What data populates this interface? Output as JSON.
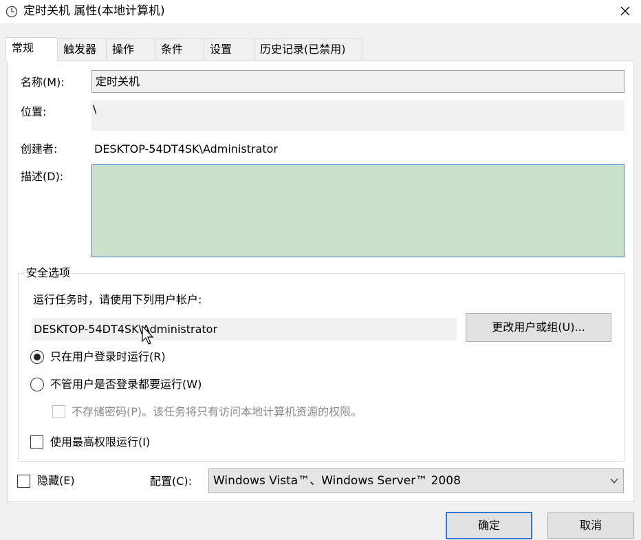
{
  "window": {
    "title": "定时关机 属性(本地计算机)",
    "close_glyph": "✕"
  },
  "tabs": [
    {
      "label": "常规",
      "active": true
    },
    {
      "label": "触发器",
      "active": false
    },
    {
      "label": "操作",
      "active": false
    },
    {
      "label": "条件",
      "active": false
    },
    {
      "label": "设置",
      "active": false
    },
    {
      "label": "历史记录(已禁用)",
      "active": false
    }
  ],
  "general": {
    "name_label": "名称(M):",
    "name_value": "定时关机",
    "location_label": "位置:",
    "location_value": "\\",
    "author_label": "创建者:",
    "author_value": "DESKTOP-54DT4SK\\Administrator",
    "description_label": "描述(D):",
    "description_value": ""
  },
  "security": {
    "group_title": "安全选项",
    "run_as_prompt": "运行任务时，请使用下列用户帐户:",
    "account_value": "DESKTOP-54DT4SK\\Administrator",
    "change_button": "更改用户或组(U)...",
    "radio_logged_on": {
      "label": "只在用户登录时运行(R)",
      "checked": true
    },
    "radio_any": {
      "label": "不管用户是否登录都要运行(W)",
      "checked": false
    },
    "no_store_password": {
      "label": "不存储密码(P)。该任务将只有访问本地计算机资源的权限。",
      "checked": false,
      "enabled": false
    },
    "highest_privileges": {
      "label": "使用最高权限运行(I)",
      "checked": false
    }
  },
  "bottom": {
    "hidden_label": "隐藏(E)",
    "hidden_checked": false,
    "config_label": "配置(C):",
    "config_value": "Windows Vista™、Windows Server™ 2008"
  },
  "buttons": {
    "ok": "确定",
    "cancel": "取消"
  },
  "colors": {
    "description_fill": "#c9e0cb",
    "focus_border": "#2c78d4"
  }
}
